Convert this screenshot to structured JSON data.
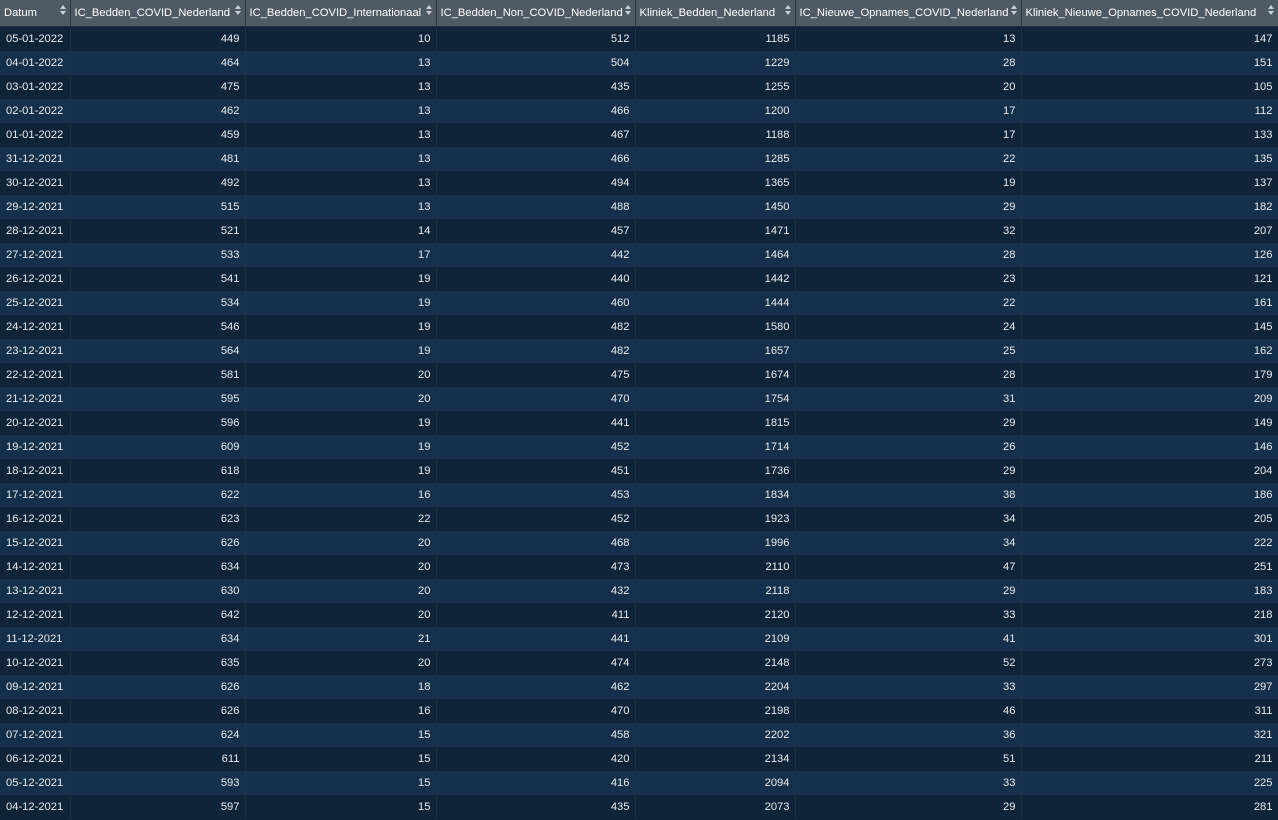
{
  "table": {
    "columns": [
      "Datum",
      "IC_Bedden_COVID_Nederland",
      "IC_Bedden_COVID_Internationaal",
      "IC_Bedden_Non_COVID_Nederland",
      "Kliniek_Bedden_Nederland",
      "IC_Nieuwe_Opnames_COVID_Nederland",
      "Kliniek_Nieuwe_Opnames_COVID_Nederland"
    ],
    "rows": [
      [
        "05-01-2022",
        "449",
        "10",
        "512",
        "1185",
        "13",
        "147"
      ],
      [
        "04-01-2022",
        "464",
        "13",
        "504",
        "1229",
        "28",
        "151"
      ],
      [
        "03-01-2022",
        "475",
        "13",
        "435",
        "1255",
        "20",
        "105"
      ],
      [
        "02-01-2022",
        "462",
        "13",
        "466",
        "1200",
        "17",
        "112"
      ],
      [
        "01-01-2022",
        "459",
        "13",
        "467",
        "1188",
        "17",
        "133"
      ],
      [
        "31-12-2021",
        "481",
        "13",
        "466",
        "1285",
        "22",
        "135"
      ],
      [
        "30-12-2021",
        "492",
        "13",
        "494",
        "1365",
        "19",
        "137"
      ],
      [
        "29-12-2021",
        "515",
        "13",
        "488",
        "1450",
        "29",
        "182"
      ],
      [
        "28-12-2021",
        "521",
        "14",
        "457",
        "1471",
        "32",
        "207"
      ],
      [
        "27-12-2021",
        "533",
        "17",
        "442",
        "1464",
        "28",
        "126"
      ],
      [
        "26-12-2021",
        "541",
        "19",
        "440",
        "1442",
        "23",
        "121"
      ],
      [
        "25-12-2021",
        "534",
        "19",
        "460",
        "1444",
        "22",
        "161"
      ],
      [
        "24-12-2021",
        "546",
        "19",
        "482",
        "1580",
        "24",
        "145"
      ],
      [
        "23-12-2021",
        "564",
        "19",
        "482",
        "1657",
        "25",
        "162"
      ],
      [
        "22-12-2021",
        "581",
        "20",
        "475",
        "1674",
        "28",
        "179"
      ],
      [
        "21-12-2021",
        "595",
        "20",
        "470",
        "1754",
        "31",
        "209"
      ],
      [
        "20-12-2021",
        "596",
        "19",
        "441",
        "1815",
        "29",
        "149"
      ],
      [
        "19-12-2021",
        "609",
        "19",
        "452",
        "1714",
        "26",
        "146"
      ],
      [
        "18-12-2021",
        "618",
        "19",
        "451",
        "1736",
        "29",
        "204"
      ],
      [
        "17-12-2021",
        "622",
        "16",
        "453",
        "1834",
        "38",
        "186"
      ],
      [
        "16-12-2021",
        "623",
        "22",
        "452",
        "1923",
        "34",
        "205"
      ],
      [
        "15-12-2021",
        "626",
        "20",
        "468",
        "1996",
        "34",
        "222"
      ],
      [
        "14-12-2021",
        "634",
        "20",
        "473",
        "2110",
        "47",
        "251"
      ],
      [
        "13-12-2021",
        "630",
        "20",
        "432",
        "2118",
        "29",
        "183"
      ],
      [
        "12-12-2021",
        "642",
        "20",
        "411",
        "2120",
        "33",
        "218"
      ],
      [
        "11-12-2021",
        "634",
        "21",
        "441",
        "2109",
        "41",
        "301"
      ],
      [
        "10-12-2021",
        "635",
        "20",
        "474",
        "2148",
        "52",
        "273"
      ],
      [
        "09-12-2021",
        "626",
        "18",
        "462",
        "2204",
        "33",
        "297"
      ],
      [
        "08-12-2021",
        "626",
        "16",
        "470",
        "2198",
        "46",
        "311"
      ],
      [
        "07-12-2021",
        "624",
        "15",
        "458",
        "2202",
        "36",
        "321"
      ],
      [
        "06-12-2021",
        "611",
        "15",
        "420",
        "2134",
        "51",
        "211"
      ],
      [
        "05-12-2021",
        "593",
        "15",
        "416",
        "2094",
        "33",
        "225"
      ],
      [
        "04-12-2021",
        "597",
        "15",
        "435",
        "2073",
        "29",
        "281"
      ]
    ]
  },
  "icons": {
    "sort": "sort-updown-icon"
  },
  "colors": {
    "header_bg": "#4f5a64",
    "row_odd": "#0f2438",
    "row_even": "#15304a",
    "text": "#e7ecf1"
  }
}
